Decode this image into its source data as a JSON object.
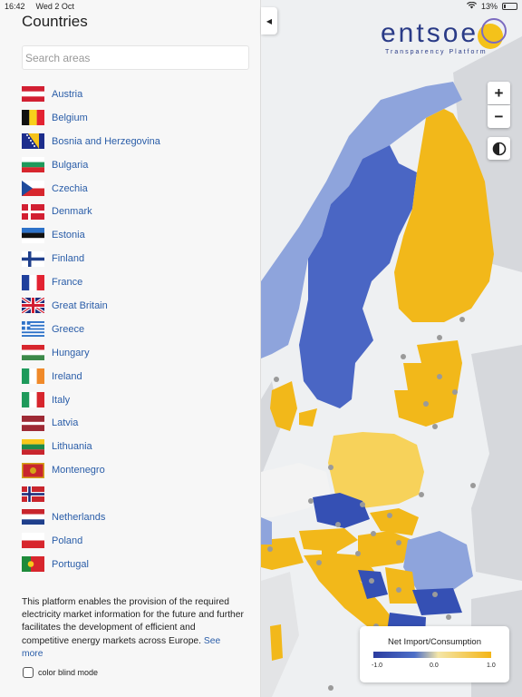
{
  "status": {
    "time": "16:42",
    "date": "Wed 2 Oct",
    "battery": "13%"
  },
  "sidebar": {
    "title": "Countries",
    "collapse_icon": "caret-left-icon",
    "search_placeholder": "Search areas",
    "countries": [
      {
        "name": "Austria",
        "flag": "austria-flag"
      },
      {
        "name": "Belgium",
        "flag": "belgium-flag"
      },
      {
        "name": "Bosnia and Herzegovina",
        "flag": "bosnia-flag"
      },
      {
        "name": "Bulgaria",
        "flag": "bulgaria-flag"
      },
      {
        "name": "Czechia",
        "flag": "czechia-flag"
      },
      {
        "name": "Denmark",
        "flag": "denmark-flag"
      },
      {
        "name": "Estonia",
        "flag": "estonia-flag"
      },
      {
        "name": "Finland",
        "flag": "finland-flag"
      },
      {
        "name": "France",
        "flag": "france-flag"
      },
      {
        "name": "Great Britain",
        "flag": "great-britain-flag"
      },
      {
        "name": "Greece",
        "flag": "greece-flag"
      },
      {
        "name": "Hungary",
        "flag": "hungary-flag"
      },
      {
        "name": "Ireland",
        "flag": "ireland-flag"
      },
      {
        "name": "Italy",
        "flag": "italy-flag"
      },
      {
        "name": "Latvia",
        "flag": "latvia-flag"
      },
      {
        "name": "Lithuania",
        "flag": "lithuania-flag"
      },
      {
        "name": "Montenegro",
        "flag": "montenegro-flag"
      },
      {
        "name": "",
        "flag": "norway-flag"
      },
      {
        "name": "Netherlands",
        "flag": "netherlands-flag"
      },
      {
        "name": "Poland",
        "flag": "poland-flag"
      },
      {
        "name": "Portugal",
        "flag": "portugal-flag"
      }
    ],
    "footer_text": "This platform enables the provision of the required electricity market information for the future and further facilitates the development of efficient and competitive energy markets across Europe.",
    "see_more": "See more",
    "color_blind_label": "color blind mode"
  },
  "logo": {
    "text": "entsoe",
    "subtitle": "Transparency Platform"
  },
  "map_controls": {
    "zoom_in": "+",
    "zoom_out": "−",
    "layer_icon": "layers-icon"
  },
  "legend": {
    "title": "Net Import/Consumption",
    "min": "-1.0",
    "mid": "0.0",
    "max": "1.0"
  },
  "colors": {
    "import_blue": "#4a66c4",
    "export_yellow": "#f2b81a",
    "light_yellow": "#f7d25a",
    "light_blue": "#8ea4dc",
    "link": "#2a5da8"
  }
}
